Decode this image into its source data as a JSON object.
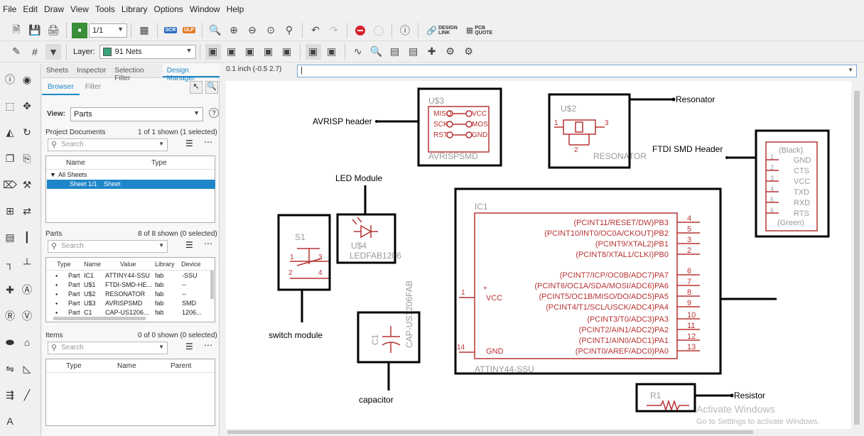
{
  "menu": [
    "File",
    "Edit",
    "Draw",
    "View",
    "Tools",
    "Library",
    "Options",
    "Window",
    "Help"
  ],
  "toolbar": {
    "sheet_combo": "1/1",
    "scr_badge": "SCR",
    "ulp_badge": "ULP",
    "design_link": [
      "DESIGN",
      "LINK"
    ],
    "pcb_quote": [
      "PCB",
      "QUOTE"
    ],
    "layer_label": "Layer:",
    "layer_value": "91 Nets",
    "layer_color": "#3aa37a",
    "stop_color": "#d9232d"
  },
  "left_icons": [
    "info-icon",
    "eye-icon",
    "select-icon",
    "move-icon",
    "mirror-icon",
    "rotate-icon",
    "copy-icon",
    "paste-icon",
    "delete-icon",
    "wrench-icon",
    "add-part-icon",
    "replace-icon",
    "gate-icon",
    "bus-icon",
    "wire-icon",
    "net-icon",
    "junction-icon",
    "label-icon",
    "name-icon",
    "value-icon",
    "smash-icon",
    "tag-icon",
    "split-icon",
    "miter-icon",
    "invoke-icon",
    "line-icon",
    "text-icon"
  ],
  "panel": {
    "tabs": [
      "Sheets",
      "Inspector",
      "Selection Filter",
      "Design Manager"
    ],
    "active_tab": 3,
    "subtabs": [
      "Browser",
      "Filter"
    ],
    "view_label": "View:",
    "view_value": "Parts",
    "project_docs": {
      "title": "Project Documents",
      "count": "1 of 1 shown (1 selected)"
    },
    "search_placeholder": "Search",
    "docs_headers": [
      "Name",
      "Type"
    ],
    "docs_tree": {
      "root": "All Sheets",
      "child": "Sheet 1/1",
      "child_type": "Sheet"
    },
    "parts": {
      "title": "Parts",
      "count": "8 of 8 shown (0 selected)"
    },
    "parts_headers": [
      "Type",
      "Name",
      "Value",
      "Library",
      "Device"
    ],
    "parts_rows": [
      [
        "Part",
        "IC1",
        "ATTINY44-SSU",
        "fab",
        "-SSU"
      ],
      [
        "Part",
        "U$1",
        "FTDI-SMD-HE...",
        "fab",
        "--"
      ],
      [
        "Part",
        "U$2",
        "RESONATOR",
        "fab",
        "--"
      ],
      [
        "Part",
        "U$3",
        "AVRISPSMD",
        "fab",
        "SMD"
      ],
      [
        "Part",
        "C1",
        "CAP-US1206...",
        "fab",
        "1206..."
      ]
    ],
    "items": {
      "title": "Items",
      "count": "0 of 0 shown (0 selected)"
    },
    "items_headers": [
      "Type",
      "Name",
      "Parent"
    ]
  },
  "coord_readout": "0.1 inch (-0.5 2.7)",
  "cmd_value": "|",
  "schematic": {
    "colors": {
      "part": "#b83232",
      "annot": "#000000",
      "ghost": "#9a9a9a"
    },
    "annotations": [
      "AVRISP header",
      "Resonator",
      "FTDI SMD Header",
      "LED Module",
      "switch module",
      "capacitor",
      "Resistor"
    ],
    "avrisp": {
      "ref": "U$3",
      "name": "AVRISPSMD",
      "left_pins": [
        "MISO",
        "SCK",
        "RST"
      ],
      "right_pins": [
        "VCC",
        "MOSI",
        "GND"
      ]
    },
    "resonator": {
      "ref": "U$2",
      "name": "RESONATOR",
      "pins": [
        "1",
        "2",
        "3"
      ]
    },
    "ftdi": {
      "top": "(Black)",
      "pins": [
        "GND",
        "CTS",
        "VCC",
        "TXD",
        "RXD",
        "RTS"
      ],
      "nums": [
        "1",
        "2",
        "3",
        "4",
        "5",
        "6"
      ],
      "bottom": "(Green)"
    },
    "led": {
      "ref": "U$4",
      "name": "LEDFAB1206"
    },
    "switch": {
      "ref": "S1",
      "pins": [
        "1",
        "2",
        "3",
        "4"
      ]
    },
    "cap": {
      "ref": "C1",
      "name": "CAP-US1206FAB"
    },
    "ic": {
      "ref": "IC1",
      "name": "ATTINY44-SSU",
      "right_pins": [
        {
          "label": "(PCINT11/RESET/DW)PB3",
          "num": "4"
        },
        {
          "label": "(PCINT10/INT0/OC0A/CKOUT)PB2",
          "num": "5"
        },
        {
          "label": "(PCINT9/XTAL2)PB1",
          "num": "3"
        },
        {
          "label": "(PCINT8/XTAL1/CLKI)PB0",
          "num": "2"
        },
        {
          "label": "(PCINT7/ICP/OC0B/ADC7)PA7",
          "num": "6"
        },
        {
          "label": "(PCINT6/OC1A/SDA/MOSI/ADC6)PA6",
          "num": "7"
        },
        {
          "label": "(PCINT5/OC1B/MISO/DO/ADC5)PA5",
          "num": "8"
        },
        {
          "label": "(PCINT4/T1/SCL/USCK/ADC4)PA4",
          "num": "9"
        },
        {
          "label": "(PCINT3/T0/ADC3)PA3",
          "num": "10"
        },
        {
          "label": "(PCINT2/AIN1/ADC2)PA2",
          "num": "11"
        },
        {
          "label": "(PCINT1/AIN0/ADC1)PA1",
          "num": "12"
        },
        {
          "label": "(PCINT0/AREF/ADC0)PA0",
          "num": "13"
        }
      ],
      "vcc": {
        "label": "VCC",
        "num": "1"
      },
      "gnd": {
        "label": "GND",
        "num": "14"
      }
    },
    "resistor": {
      "ref": "R1"
    },
    "watermark": {
      "line1": "Activate Windows",
      "line2": "Go to Settings to activate Windows."
    }
  }
}
